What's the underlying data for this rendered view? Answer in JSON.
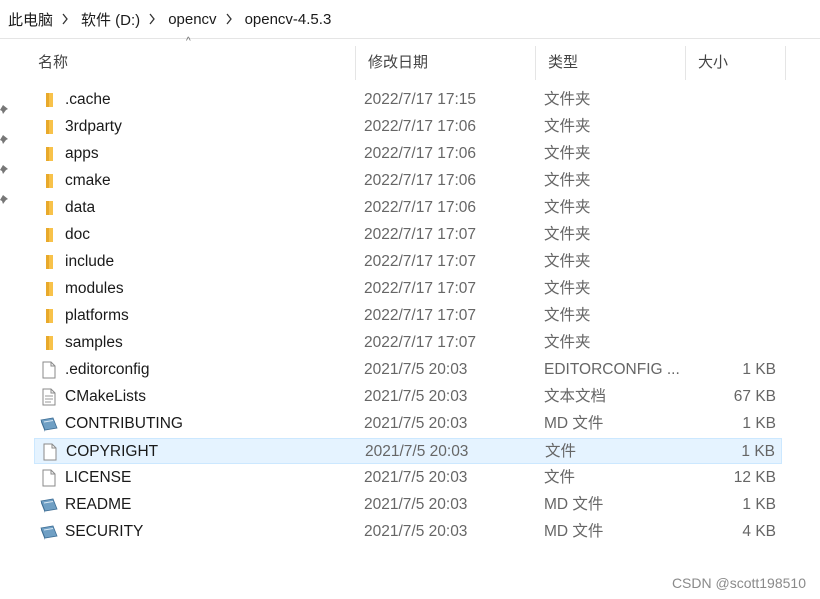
{
  "breadcrumb": [
    "此电脑",
    "软件 (D:)",
    "opencv",
    "opencv-4.5.3"
  ],
  "columns": {
    "name": "名称",
    "date": "修改日期",
    "type": "类型",
    "size": "大小"
  },
  "files": [
    {
      "name": ".cache",
      "date": "2022/7/17 17:15",
      "type": "文件夹",
      "size": "",
      "icon": "folder-icon"
    },
    {
      "name": "3rdparty",
      "date": "2022/7/17 17:06",
      "type": "文件夹",
      "size": "",
      "icon": "folder-icon"
    },
    {
      "name": "apps",
      "date": "2022/7/17 17:06",
      "type": "文件夹",
      "size": "",
      "icon": "folder-icon"
    },
    {
      "name": "cmake",
      "date": "2022/7/17 17:06",
      "type": "文件夹",
      "size": "",
      "icon": "folder-icon"
    },
    {
      "name": "data",
      "date": "2022/7/17 17:06",
      "type": "文件夹",
      "size": "",
      "icon": "folder-icon"
    },
    {
      "name": "doc",
      "date": "2022/7/17 17:07",
      "type": "文件夹",
      "size": "",
      "icon": "folder-icon"
    },
    {
      "name": "include",
      "date": "2022/7/17 17:07",
      "type": "文件夹",
      "size": "",
      "icon": "folder-icon"
    },
    {
      "name": "modules",
      "date": "2022/7/17 17:07",
      "type": "文件夹",
      "size": "",
      "icon": "folder-icon"
    },
    {
      "name": "platforms",
      "date": "2022/7/17 17:07",
      "type": "文件夹",
      "size": "",
      "icon": "folder-icon"
    },
    {
      "name": "samples",
      "date": "2022/7/17 17:07",
      "type": "文件夹",
      "size": "",
      "icon": "folder-icon"
    },
    {
      "name": ".editorconfig",
      "date": "2021/7/5 20:03",
      "type": "EDITORCONFIG ...",
      "size": "1 KB",
      "icon": "file-icon"
    },
    {
      "name": "CMakeLists",
      "date": "2021/7/5 20:03",
      "type": "文本文档",
      "size": "67 KB",
      "icon": "text-file-icon"
    },
    {
      "name": "CONTRIBUTING",
      "date": "2021/7/5 20:03",
      "type": "MD 文件",
      "size": "1 KB",
      "icon": "markdown-file-icon"
    },
    {
      "name": "COPYRIGHT",
      "date": "2021/7/5 20:03",
      "type": "文件",
      "size": "1 KB",
      "icon": "file-icon",
      "selected": true
    },
    {
      "name": "LICENSE",
      "date": "2021/7/5 20:03",
      "type": "文件",
      "size": "12 KB",
      "icon": "file-icon"
    },
    {
      "name": "README",
      "date": "2021/7/5 20:03",
      "type": "MD 文件",
      "size": "1 KB",
      "icon": "markdown-file-icon"
    },
    {
      "name": "SECURITY",
      "date": "2021/7/5 20:03",
      "type": "MD 文件",
      "size": "4 KB",
      "icon": "markdown-file-icon"
    }
  ],
  "watermark": "CSDN @scott198510",
  "colors": {
    "folder": "#f8c24a",
    "selection_bg": "#e5f3ff",
    "selection_border": "#cce8ff"
  }
}
